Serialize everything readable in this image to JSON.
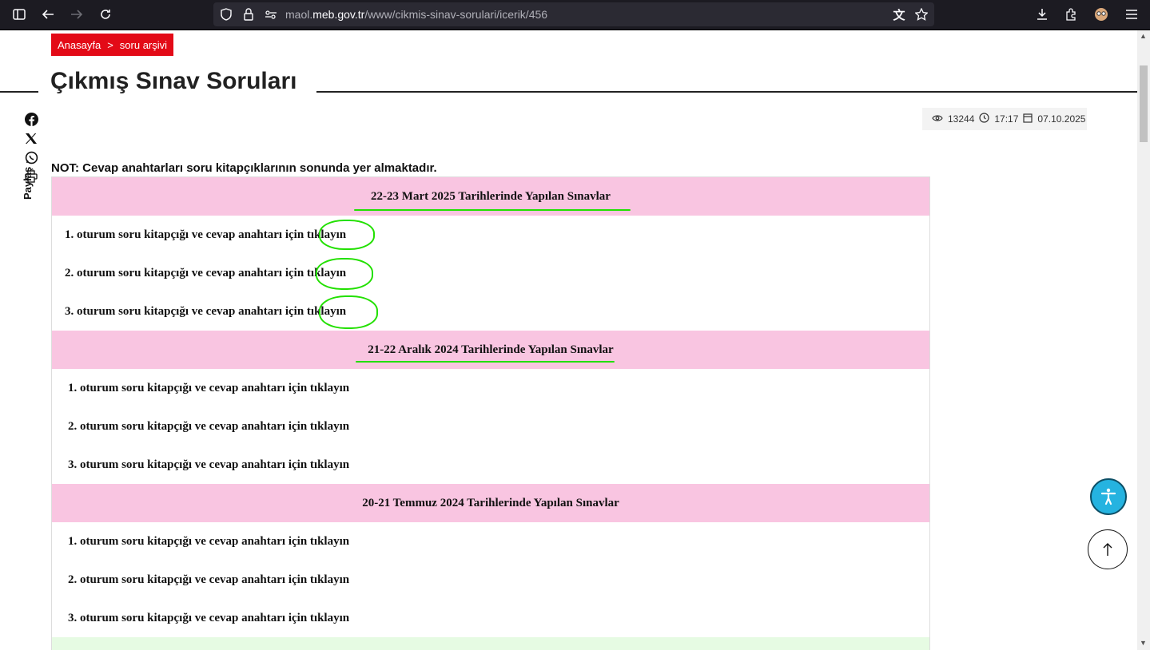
{
  "browser": {
    "url_prefix": "maol.",
    "url_domain": "meb.gov.tr",
    "url_path": "/www/cikmis-sinav-sorulari/icerik/456"
  },
  "breadcrumb": {
    "home": "Anasayfa",
    "separator": ">",
    "current": "soru arşivi"
  },
  "page_title": "Çıkmış Sınav Soruları",
  "share": {
    "label": "Paylaş"
  },
  "meta": {
    "views": "13244",
    "time": "17:17",
    "date": "07.10.2025"
  },
  "note": "NOT: Cevap anahtarları soru kitapçıklarının sonunda yer almaktadır.",
  "sections": [
    {
      "title": "22-23 Mart 2025 Tarihlerinde Yapılan Sınavlar",
      "rows": [
        {
          "text": "1. oturum soru kitapçığı ve cevap anahtarı için ",
          "link": "tıklayın"
        },
        {
          "text": "2. oturum soru kitapçığı ve cevap anahtarı için ",
          "link": "tıklayın"
        },
        {
          "text": "3. oturum soru kitapçığı ve cevap anahtarı için ",
          "link": "tıklayın"
        }
      ]
    },
    {
      "title": "21-22 Aralık 2024 Tarihlerinde Yapılan Sınavlar",
      "rows": [
        {
          "text": "1. oturum soru kitapçığı ve cevap anahtarı için ",
          "link": "tıklayın"
        },
        {
          "text": "2. oturum soru kitapçığı ve cevap anahtarı için ",
          "link": "tıklayın"
        },
        {
          "text": "3. oturum soru kitapçığı ve cevap anahtarı için ",
          "link": "tıklayın"
        }
      ]
    },
    {
      "title": "20-21 Temmuz 2024 Tarihlerinde Yapılan Sınavlar",
      "rows": [
        {
          "text": "1. oturum soru kitapçığı ve cevap anahtarı için ",
          "link": "tıklayın"
        },
        {
          "text": "2. oturum soru kitapçığı ve cevap anahtarı için ",
          "link": "tıklayın"
        },
        {
          "text": "3. oturum soru kitapçığı ve cevap anahtarı için ",
          "link": "tıklayın"
        }
      ]
    }
  ],
  "colors": {
    "breadcrumb_bg": "#e30a17",
    "section_head_bg": "#f9c5e1",
    "annotation": "#22e000"
  }
}
